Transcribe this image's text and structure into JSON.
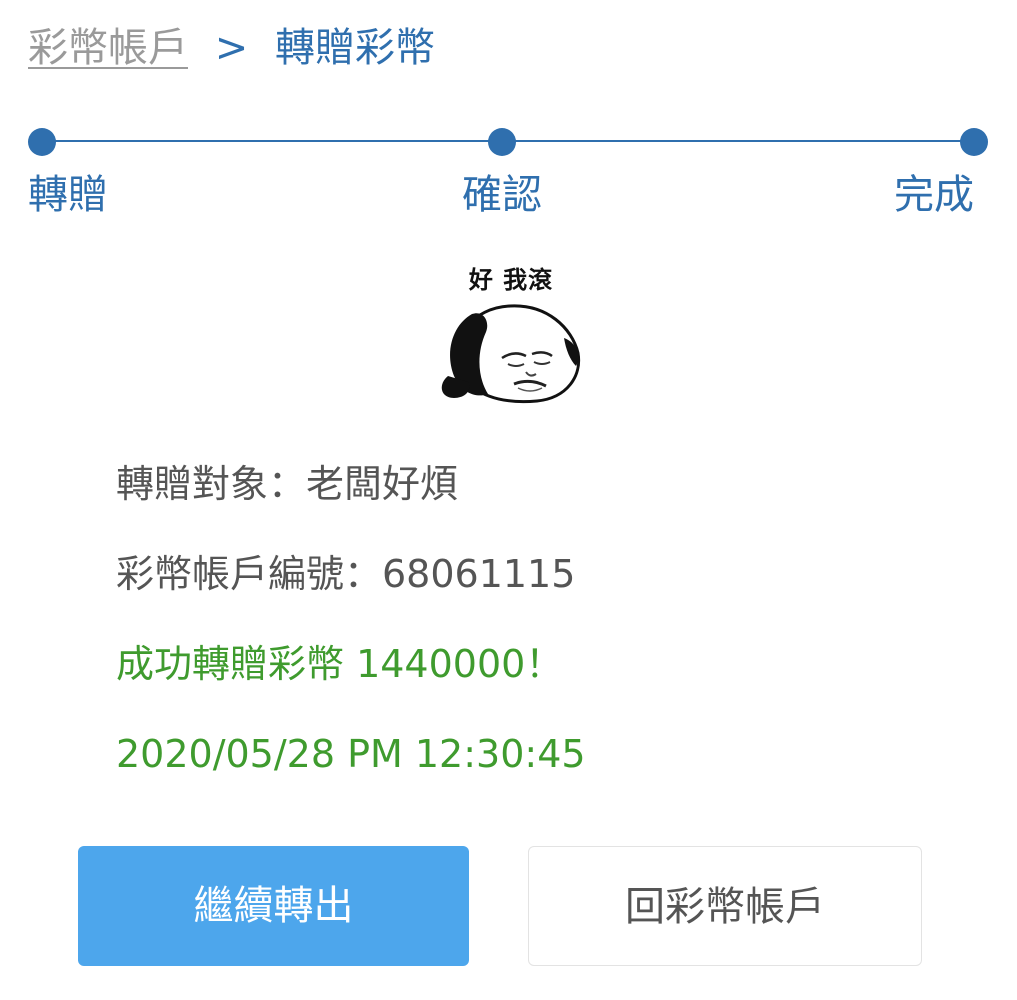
{
  "breadcrumb": {
    "link": "彩幣帳戶",
    "separator": ">",
    "current": "轉贈彩幣"
  },
  "steps": [
    {
      "label": "轉贈"
    },
    {
      "label": "確認"
    },
    {
      "label": "完成"
    }
  ],
  "meme": {
    "caption": "好 我滾"
  },
  "info": {
    "recipient": "轉贈對象：老闆好煩",
    "account_number": "彩幣帳戶編號：68061115",
    "success_message": "成功轉贈彩幣 1440000！",
    "timestamp": "2020/05/28 PM 12:30:45"
  },
  "buttons": {
    "continue_label": "繼續轉出",
    "back_label": "回彩幣帳戶"
  },
  "colors": {
    "primary_blue": "#2f6fae",
    "button_blue": "#4da6ec",
    "success_green": "#3f9b2e",
    "text_grey": "#555555",
    "link_grey": "#9a9a9a"
  }
}
